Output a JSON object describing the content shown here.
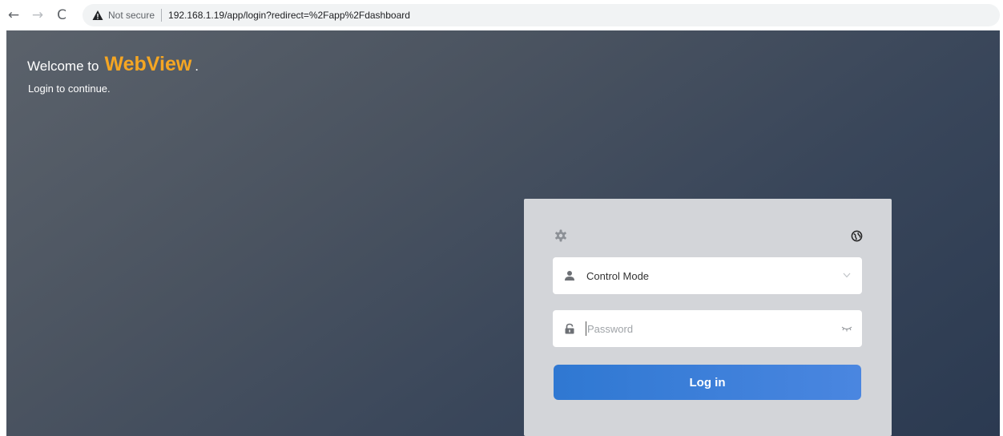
{
  "browser": {
    "back_glyph": "←",
    "forward_glyph": "→",
    "reload_glyph": "C",
    "security_label": "Not secure",
    "url": "192.168.1.19/app/login?redirect=%2Fapp%2Fdashboard"
  },
  "welcome": {
    "prefix": "Welcome to",
    "brand": "WebView",
    "suffix": ".",
    "subtitle": "Login to continue.",
    "brand_color": "#f5a623"
  },
  "login": {
    "mode_value": "Control Mode",
    "password_placeholder": "Password",
    "password_value": "",
    "submit_label": "Log in",
    "button_color": "#3a7fd8",
    "icons": [
      "settings-icon",
      "globe-icon",
      "user-icon",
      "lock-icon",
      "chevron-down-icon",
      "eye-closed-icon"
    ]
  }
}
